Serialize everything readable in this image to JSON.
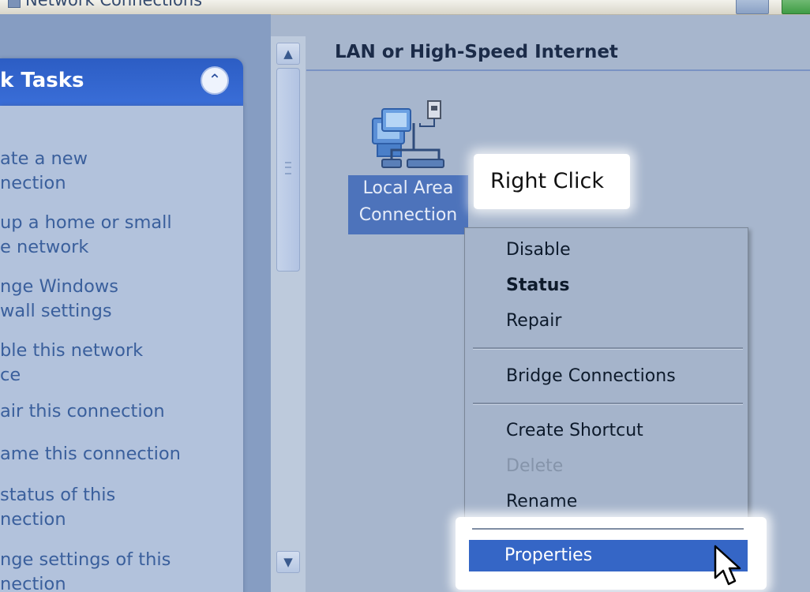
{
  "window": {
    "title": "Network Connections"
  },
  "task_pane": {
    "header": "k Tasks",
    "items": [
      "ate a new\nnection",
      "up a home or small\ne network",
      "nge Windows\nwall settings",
      "ble this network\nce",
      "air this connection",
      "ame this connection",
      "status of this\nnection",
      "nge settings of this\nnection"
    ]
  },
  "scrollbar": {
    "up_icon": "chevron-up-icon",
    "down_icon": "chevron-down-icon"
  },
  "main": {
    "group_header": "LAN or High-Speed Internet",
    "connection": {
      "label": "Local Area\nConnection",
      "icon": "network-connection-icon"
    }
  },
  "callout": {
    "text": "Right Click"
  },
  "context_menu": {
    "items": [
      {
        "label": "Disable",
        "style": "normal"
      },
      {
        "label": "Status",
        "style": "bold"
      },
      {
        "label": "Repair",
        "style": "normal"
      },
      {
        "label": "Bridge Connections",
        "style": "normal"
      },
      {
        "label": "Create Shortcut",
        "style": "normal"
      },
      {
        "label": "Delete",
        "style": "disabled"
      },
      {
        "label": "Rename",
        "style": "normal"
      },
      {
        "label": "Properties",
        "style": "highlighted"
      }
    ]
  },
  "colors": {
    "background": "#a7b6cd",
    "task_header": "#2c5dc4",
    "selection": "#3566c6",
    "connection_selection": "#4d73bb"
  }
}
